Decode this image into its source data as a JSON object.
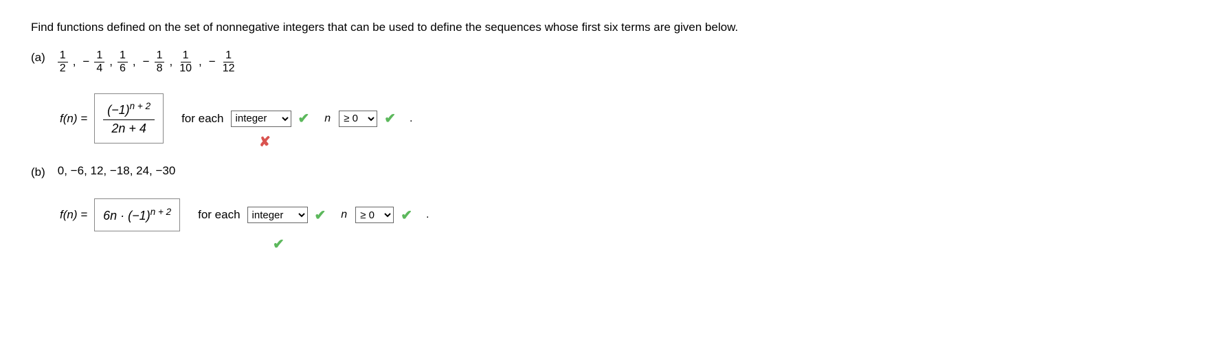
{
  "question": "Find functions defined on the set of nonnegative integers that can be used to define the sequences whose first six terms are given below.",
  "parts": {
    "a": {
      "label": "(a)",
      "sequence_fracs": [
        {
          "sign": "",
          "num": "1",
          "den": "2"
        },
        {
          "sign": "−",
          "num": "1",
          "den": "4"
        },
        {
          "sign": "",
          "num": "1",
          "den": "6"
        },
        {
          "sign": "−",
          "num": "1",
          "den": "8"
        },
        {
          "sign": "",
          "num": "1",
          "den": "10"
        },
        {
          "sign": "−",
          "num": "1",
          "den": "12"
        }
      ],
      "fn_label": "f(n) =",
      "answer_numer_base": "(−1)",
      "answer_numer_exp": "n + 2",
      "answer_denom": "2n + 4",
      "mark": "incorrect",
      "for_each": "for each",
      "dropdown1_value": "integer",
      "n_var": "n",
      "dropdown2_value": "≥ 0",
      "period": "."
    },
    "b": {
      "label": "(b)",
      "sequence_text": "0, −6, 12, −18, 24, −30",
      "fn_label": "f(n) =",
      "answer_part1": "6n · (−1)",
      "answer_exp": "n + 2",
      "mark": "correct",
      "for_each": "for each",
      "dropdown1_value": "integer",
      "n_var": "n",
      "dropdown2_value": "≥ 0",
      "period": "."
    }
  },
  "dropdown_options": {
    "type": [
      "integer"
    ],
    "range": [
      "≥ 0"
    ]
  },
  "icons": {
    "correct": "✔",
    "incorrect": "✘"
  }
}
